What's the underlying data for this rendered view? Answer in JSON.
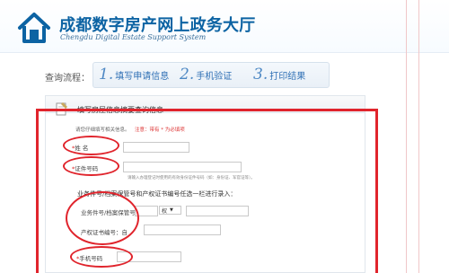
{
  "header": {
    "title_cn": "成都数字房产网上政务大厅",
    "title_en": "Chengdu Digital Estate Support System"
  },
  "steps": {
    "label": "查询流程：",
    "items": [
      {
        "num": "1.",
        "text": "填写申请信息"
      },
      {
        "num": "2.",
        "text": "手机验证"
      },
      {
        "num": "3.",
        "text": "打印结果"
      }
    ]
  },
  "panel": {
    "title": "填写房屋信息摘要查询信息",
    "tip": "请您仔细填写相关信息。",
    "tip_note": "注意：带有 * 为必填项",
    "fields": {
      "name_label": "姓    名",
      "id_label": "证件号码",
      "id_hint": "请输入办理登记时使用的有效身份证件号码（如：身份证、军官证等）。",
      "section_title": "业务件号/档案保管号和产权证书编号任选一栏进行录入：",
      "business_label": "业务件号/档案保管号",
      "business_select": "权",
      "cert_label": "产权证书编号",
      "cert_prefix": "：自",
      "phone_label": "手机号码"
    },
    "required_mark": "*"
  },
  "colors": {
    "brand_blue": "#0c63a3",
    "step_blue": "#2f70b5",
    "annotation_red": "#e0242c"
  }
}
